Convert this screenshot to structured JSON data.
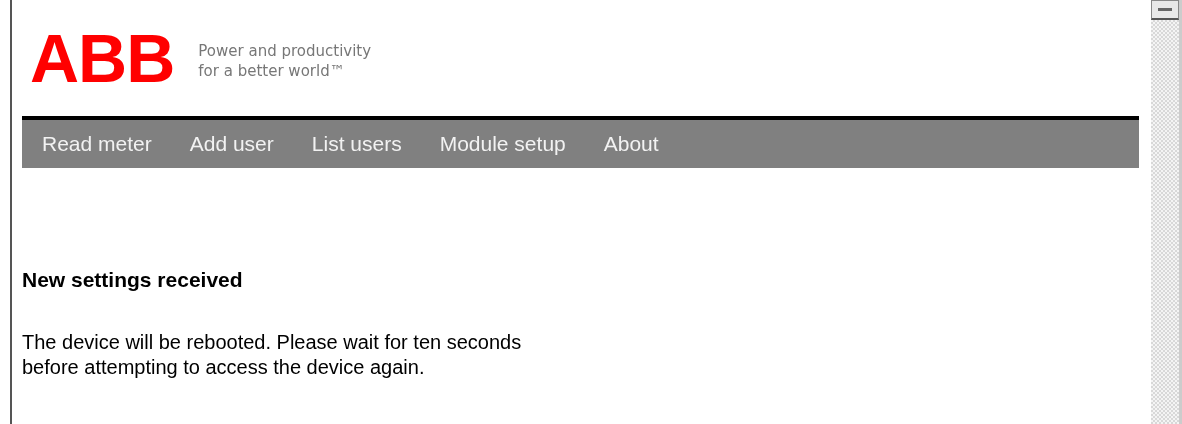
{
  "header": {
    "logo": "ABB",
    "tagline": [
      "Power and productivity",
      "for a better world™"
    ]
  },
  "nav": [
    {
      "label": "Read meter"
    },
    {
      "label": "Add user"
    },
    {
      "label": "List users"
    },
    {
      "label": "Module setup"
    },
    {
      "label": "About"
    }
  ],
  "message": {
    "heading": "New settings received",
    "body": [
      "The device will be rebooted. Please wait for ten seconds",
      "before attempting to access the device again."
    ]
  }
}
